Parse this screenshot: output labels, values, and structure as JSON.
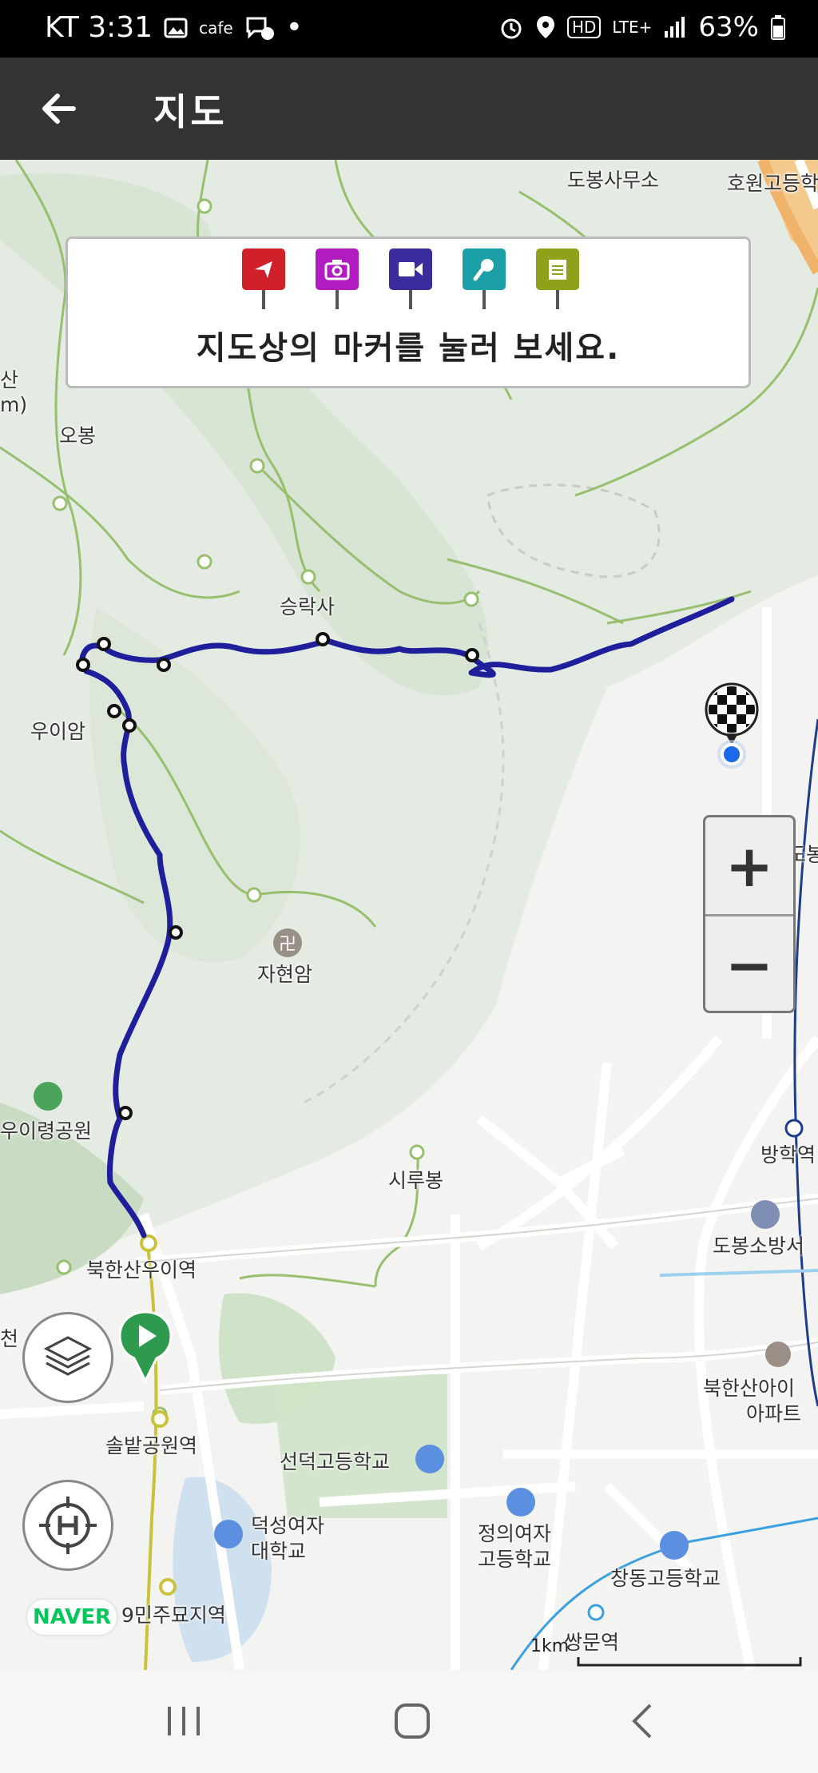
{
  "status_bar": {
    "carrier_time": "KT 3:31",
    "cafe": "cafe",
    "dot": "•",
    "lte": "LTE+",
    "hd": "HD",
    "battery": "63%"
  },
  "app_bar": {
    "title": "지도"
  },
  "hint": {
    "text": "지도상의 마커를 눌러 보세요.",
    "marker_icons": [
      "flag-icon",
      "camera-icon",
      "video-icon",
      "microphone-icon",
      "notepad-icon"
    ],
    "marker_colors": [
      "#d0202a",
      "#b01cc0",
      "#3a2c9c",
      "#1aa0a6",
      "#8fa01a"
    ]
  },
  "map": {
    "labels": {
      "dobong_office": "도봉사무소",
      "howon_high": "호원고등학",
      "obong": "오봉",
      "m_fragment": "m)",
      "san_fragment": "산",
      "seungraksa": "승락사",
      "uiam": "우이암",
      "jahyeonam": "자현암",
      "uiryeong_park": "우이령공원",
      "sirubong": "시루봉",
      "bukhansan_ui_station": "북한산우이역",
      "cheon_fragment": "천",
      "solbat_station": "솔밭공원역",
      "seondeok_high": "선덕고등학교",
      "deoksung_univ_1": "덕성여자",
      "deoksung_univ_2": "대학교",
      "jeongui_high_1": "정의여자",
      "jeongui_high_2": "고등학교",
      "changdong_high": "창동고등학교",
      "april19_station": "9민주묘지역",
      "ssangmun_station": "쌍문역",
      "banghak_station": "방학역",
      "dobong_fire": "도봉소방서",
      "bukhansan_apt_1": "북한산아이",
      "bukhansan_apt_2": "아파트",
      "dobong_fragment": "도봉"
    },
    "zoom_in": "+",
    "zoom_out": "−",
    "scale": "1km",
    "brand": "NAVER",
    "route_color": "#1f1f9c"
  },
  "nav_bar": {
    "recent": "recent-apps-icon",
    "home": "home-icon",
    "back": "back-icon"
  }
}
